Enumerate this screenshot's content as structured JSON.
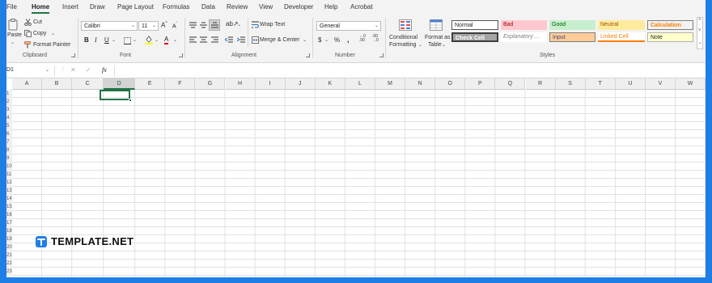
{
  "tabs": [
    "File",
    "Home",
    "Insert",
    "Draw",
    "Page Layout",
    "Formulas",
    "Data",
    "Review",
    "View",
    "Developer",
    "Help",
    "Acrobat"
  ],
  "active_tab": "Home",
  "clipboard": {
    "paste": "Paste",
    "cut": "Cut",
    "copy": "Copy",
    "format_painter": "Format Painter",
    "label": "Clipboard"
  },
  "font": {
    "family": "Calibri",
    "size": "11",
    "bold": "B",
    "italic": "I",
    "underline": "U",
    "label": "Font"
  },
  "alignment": {
    "wrap_text": "Wrap Text",
    "merge_center": "Merge & Center",
    "label": "Alignment"
  },
  "number": {
    "format": "General",
    "label": "Number"
  },
  "styles": {
    "conditional_formatting": [
      "Conditional",
      "Formatting"
    ],
    "format_as_table": [
      "Format as",
      "Table"
    ],
    "cells": [
      {
        "label": "Normal",
        "bg": "#ffffff",
        "fg": "#222222"
      },
      {
        "label": "Bad",
        "bg": "#ffc7ce",
        "fg": "#9c0006"
      },
      {
        "label": "Good",
        "bg": "#c6efce",
        "fg": "#006100"
      },
      {
        "label": "Neutral",
        "bg": "#ffeb9c",
        "fg": "#9c5700"
      },
      {
        "label": "Calculation",
        "bg": "#f2f2f2",
        "fg": "#fa7d00"
      },
      {
        "label": "Check Cell",
        "bg": "#a5a5a5",
        "fg": "#ffffff"
      },
      {
        "label": "Explanatory ...",
        "bg": "#ffffff",
        "fg": "#7f7f7f"
      },
      {
        "label": "Input",
        "bg": "#ffcc99",
        "fg": "#3f3f76"
      },
      {
        "label": "Linked Cell",
        "bg": "#ffffff",
        "fg": "#fa7d00"
      },
      {
        "label": "Note",
        "bg": "#ffffcc",
        "fg": "#222222"
      }
    ],
    "label": "Styles"
  },
  "formula_bar": {
    "name_box": "D1",
    "fx": "fx",
    "content": ""
  },
  "columns": [
    "A",
    "B",
    "C",
    "D",
    "E",
    "F",
    "G",
    "H",
    "I",
    "J",
    "K",
    "L",
    "M",
    "N",
    "O",
    "P",
    "Q",
    "R",
    "S",
    "T",
    "U",
    "V",
    "W"
  ],
  "selected_column": "D",
  "row_numbers": [
    "1",
    "2",
    "3",
    "4",
    "5",
    "6",
    "7",
    "8",
    "9",
    "10",
    "11",
    "12",
    "13",
    "14",
    "15",
    "16",
    "17",
    "18",
    "19",
    "20",
    "21",
    "22",
    "23"
  ],
  "brand": "TEMPLATE.NET",
  "colors": {
    "accent": "#217346",
    "background": "#1f7ee6"
  }
}
